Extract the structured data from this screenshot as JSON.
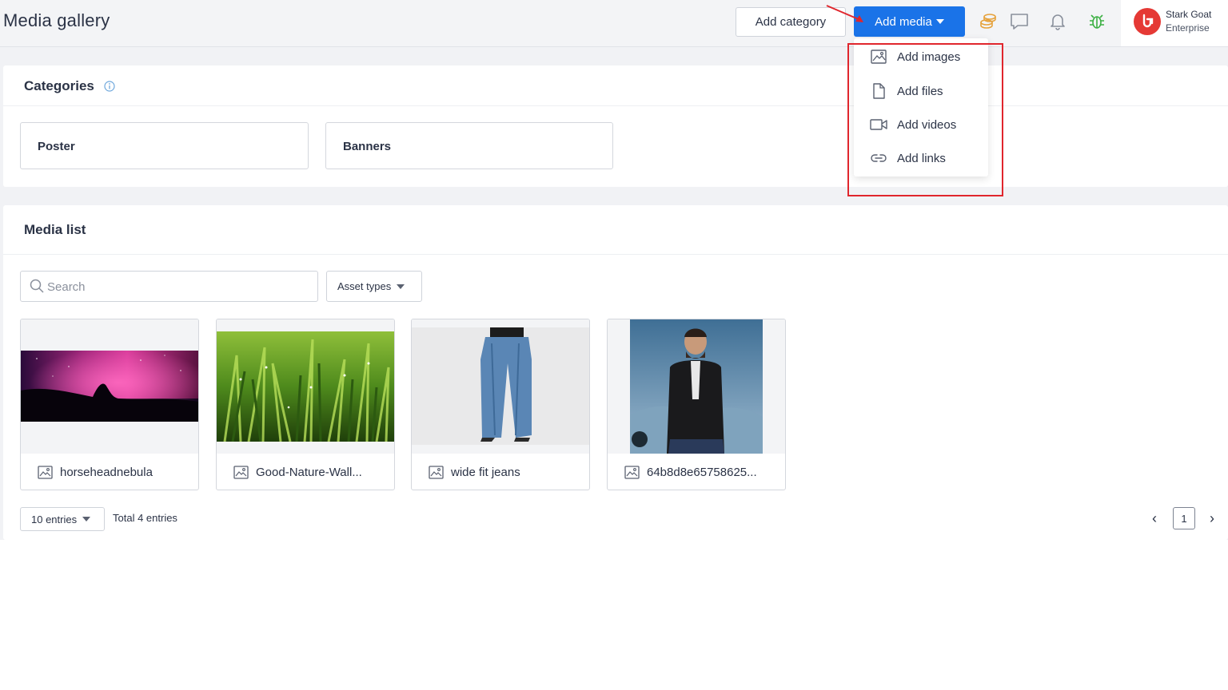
{
  "header": {
    "title": "Media gallery",
    "add_category_label": "Add category",
    "add_media_label": "Add media",
    "user": {
      "name": "Stark Goat",
      "org": "Enterprise"
    }
  },
  "dropdown": {
    "items": [
      {
        "label": "Add images",
        "icon": "image-icon"
      },
      {
        "label": "Add files",
        "icon": "file-icon"
      },
      {
        "label": "Add videos",
        "icon": "video-icon"
      },
      {
        "label": "Add links",
        "icon": "link-icon"
      }
    ]
  },
  "categories": {
    "title": "Categories",
    "items": [
      "Poster",
      "Banners"
    ]
  },
  "media": {
    "title": "Media list",
    "search_placeholder": "Search",
    "asset_types_label": "Asset types",
    "items": [
      {
        "name": "horseheadnebula"
      },
      {
        "name": "Good-Nature-Wall..."
      },
      {
        "name": "wide fit jeans"
      },
      {
        "name": "64b8d8e65758625..."
      }
    ],
    "entries_label": "10 entries",
    "total_label": "Total 4 entries",
    "current_page": "1",
    "prev_glyph": "‹",
    "next_glyph": "›"
  },
  "colors": {
    "primary": "#1a73e8",
    "highlight": "#e0262d",
    "avatar": "#e53935"
  }
}
